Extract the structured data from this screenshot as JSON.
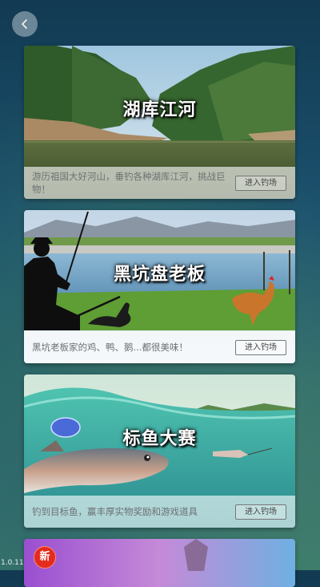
{
  "back_label": "<",
  "version": "1.0.11",
  "new_badge": "新",
  "cards": [
    {
      "title": "湖库江河",
      "description": "游历祖国大好河山，垂钓各种湖库江河，挑战巨物！",
      "button": "进入钓场"
    },
    {
      "title": "黑坑盘老板",
      "description": "黑坑老板家的鸡、鸭、鹅...都很美味！",
      "button": "进入钓场"
    },
    {
      "title": "标鱼大赛",
      "description": "钓到目标鱼，赢丰厚实物奖励和游戏道具",
      "button": "进入钓场"
    }
  ],
  "colors": {
    "badge": "#e32b1e",
    "enter_border": "#777777"
  }
}
